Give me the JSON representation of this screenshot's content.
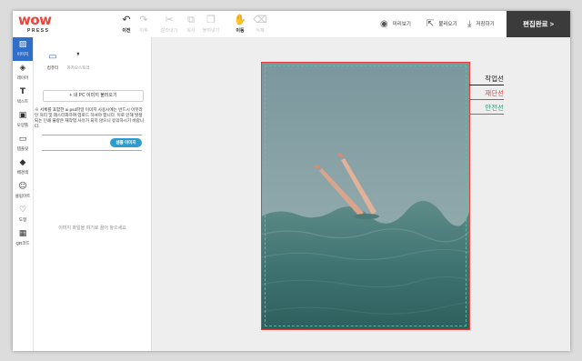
{
  "logo": {
    "main": "wow",
    "sub": "PRESS"
  },
  "toolbar": {
    "undo": "이전",
    "redo": "이후",
    "cut": "잘라내기",
    "copy": "복사",
    "paste": "붙여넣기",
    "move": "이동",
    "delete": "삭제",
    "preview": "미리보기",
    "load": "불러오기",
    "save": "저장하기",
    "finish": "편집완료 >"
  },
  "sidebar": {
    "items": [
      {
        "label": "이미지",
        "icon": "image-icon",
        "active": true
      },
      {
        "label": "레이어",
        "icon": "layers-icon"
      },
      {
        "label": "텍스트",
        "icon": "text-icon"
      },
      {
        "label": "모양틀",
        "icon": "frame-icon"
      },
      {
        "label": "템플릿",
        "icon": "template-icon"
      },
      {
        "label": "배경색",
        "icon": "paint-bucket-icon"
      },
      {
        "label": "클립아트",
        "icon": "smiley-icon"
      },
      {
        "label": "도형",
        "icon": "heart-icon"
      },
      {
        "label": "QR코드",
        "icon": "qr-code-icon"
      }
    ]
  },
  "panel": {
    "tabs": [
      {
        "label": "컴퓨터",
        "icon": "monitor-icon",
        "active": true
      },
      {
        "label": "카카오스토리",
        "icon": "kakaostory-icon"
      }
    ],
    "upload_button": "+ 내 PC 이미지 불러오기",
    "notice": "※ 서체를 포함한 ai,psd파일 이미지 사용시에는 반드시 아웃라인 처리 및 래스터화하여 업로드 하셔야 합니다. 이로 인해 발생되는 인쇄 불량은 재작업 사유가 되지 않으니 유의하시기 바랍니다.",
    "sample_button": "샘플 이미지",
    "drop_text": "이미지 파일을 여기로 끌어 놓으세요"
  },
  "guides": [
    {
      "label": "작업선",
      "color": "#222222"
    },
    {
      "label": "재단선",
      "color": "#e83c3c"
    },
    {
      "label": "안전선",
      "color": "#1fa37a"
    }
  ],
  "colors": {
    "accent": "#2f6ec9",
    "sample_button": "#2b9ed1",
    "finish_button": "#3b3b3b",
    "logo": "#e8453c"
  }
}
